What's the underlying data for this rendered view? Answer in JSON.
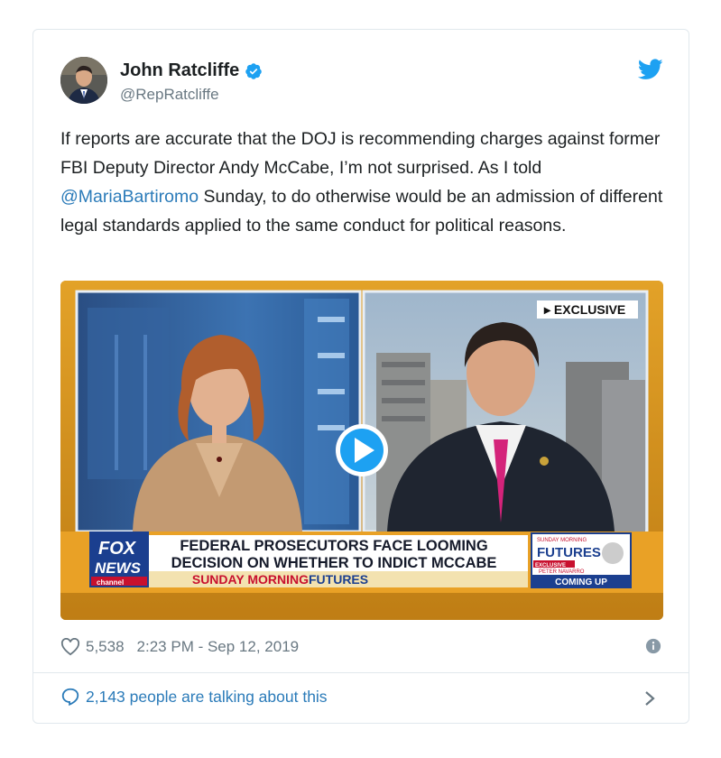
{
  "tweet": {
    "author_name": "John Ratcliffe",
    "author_handle": "@RepRatcliffe",
    "text_part1": "If reports are accurate that the DOJ is recommending charges against former FBI Deputy Director Andy McCabe, I’m not surprised. As I told ",
    "mention": "@MariaBartiromo",
    "text_part2": " Sunday, to do otherwise would be an admission of different legal standards applied to the same conduct for political reasons.",
    "likes": "5,538",
    "timestamp": "2:23 PM - Sep 12, 2019",
    "talking": "2,143 people are talking about this"
  },
  "video": {
    "exclusive_label": "▸ EXCLUSIVE",
    "network_logo_line1": "FOX",
    "network_logo_line2": "NEWS",
    "network_logo_line3": "channel",
    "headline_line1": "FEDERAL PROSECUTORS FACE LOOMING",
    "headline_line2": "DECISION ON WHETHER TO INDICT MCCABE",
    "show_name_part1": "SUNDAY MORNING",
    "show_name_part2": " FUTURES",
    "promo_top": "SUNDAY MORNING",
    "promo_brand": "FUTURES",
    "promo_tag": "EXCLUSIVE",
    "promo_guest": "PETER NAVARRO",
    "promo_bottom": "COMING UP"
  },
  "colors": {
    "twitter_blue": "#1da1f2",
    "link_blue": "#2b7bb9",
    "muted_gray": "#697882",
    "fox_gold": "#c98a1a",
    "chyron_red": "#c8102e",
    "promo_blue": "#1b3f8f"
  }
}
